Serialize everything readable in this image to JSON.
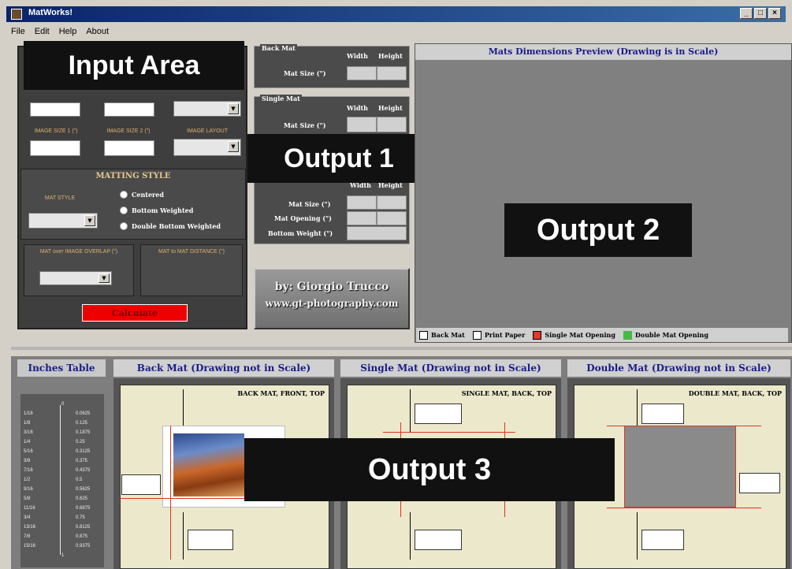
{
  "window": {
    "title": "MatWorks!",
    "controls": [
      "_",
      "□",
      "×"
    ]
  },
  "menu": [
    "File",
    "Edit",
    "Help",
    "About"
  ],
  "overlays": {
    "input_area": "Input Area",
    "output1": "Output 1",
    "output2": "Output 2",
    "output3": "Output 3"
  },
  "input": {
    "image_size_1": "IMAGE SIZE 1 (\")",
    "image_size_2": "IMAGE SIZE 2 (\")",
    "image_layout": "IMAGE LAYOUT",
    "matting_style": "MATTING STYLE",
    "mat_style": "MAT STYLE",
    "options": [
      "Centered",
      "Bottom Weighted",
      "Double Bottom Weighted"
    ],
    "overlap": "MAT over IMAGE OVERLAP (\")",
    "distance": "MAT to MAT DISTANCE (\")",
    "calculate": "Calculate"
  },
  "output1": {
    "back_mat": "Back Mat",
    "single_mat": "Single Mat",
    "width": "Width",
    "height": "Height",
    "mat_size": "Mat Size (\")",
    "mat_opening": "Mat Opening (\")",
    "bottom_weight": "Bottom Weight (\")"
  },
  "credit": {
    "line1": "by: Giorgio Trucco",
    "line2": "www.gt-photography.com"
  },
  "preview": {
    "title": "Mats Dimensions Preview (Drawing is in Scale)",
    "legend": [
      "Back Mat",
      "Print Paper",
      "Single Mat Opening",
      "Double Mat Opening"
    ],
    "colors": {
      "back": "#ffffff",
      "paper": "#ffffff",
      "single": "#e8322b",
      "double": "#44bb44"
    }
  },
  "bottom": {
    "inches_table": "Inches Table",
    "back_hdr": "Back Mat (Drawing not in Scale)",
    "single_hdr": "Single Mat (Drawing not in Scale)",
    "double_hdr": "Double Mat (Drawing not in Scale)",
    "back_cap": "BACK MAT, FRONT, TOP",
    "single_cap": "SINGLE MAT, BACK, TOP",
    "double_cap": "DOUBLE MAT, BACK, TOP",
    "fractions": [
      "1/16",
      "1/8",
      "3/16",
      "1/4",
      "5/16",
      "3/8",
      "7/16",
      "1/2",
      "9/16",
      "5/8",
      "11/16",
      "3/4",
      "13/16",
      "7/8",
      "15/16"
    ],
    "decimals": [
      "0",
      "0.0625",
      "0.125",
      "0.1875",
      "0.25",
      "0.3125",
      "0.375",
      "0.4375",
      "0.5",
      "0.5625",
      "0.625",
      "0.6875",
      "0.75",
      "0.8125",
      "0.875",
      "0.9375",
      "1"
    ]
  }
}
